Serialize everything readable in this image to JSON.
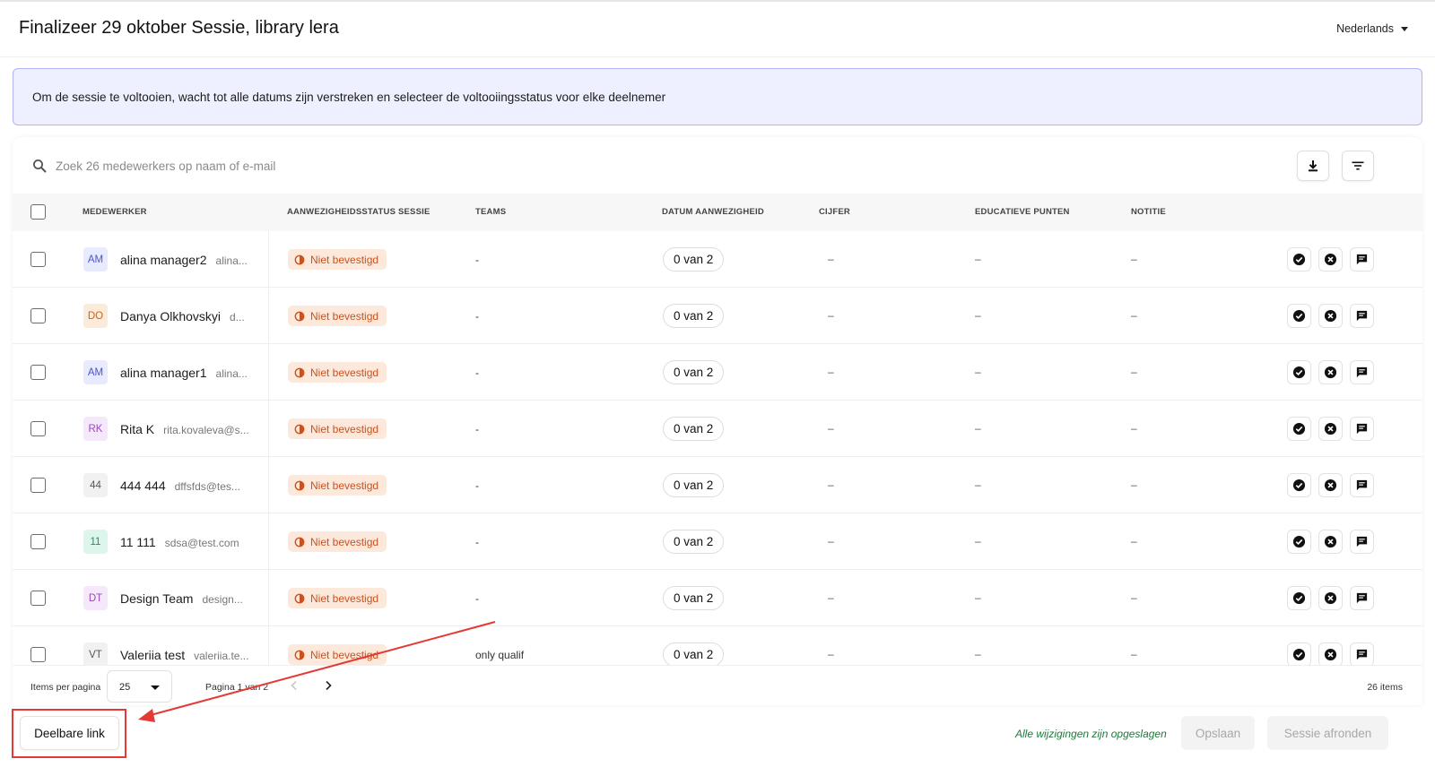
{
  "header": {
    "title": "Finalizeer 29 oktober Sessie, library lera",
    "language": "Nederlands"
  },
  "banner": {
    "text": "Om de sessie te voltooien, wacht tot alle datums zijn verstreken en selecteer de voltooiingsstatus voor elke deelnemer"
  },
  "search": {
    "placeholder": "Zoek 26 medewerkers op naam of e-mail"
  },
  "table": {
    "columns": {
      "employee": "MEDEWERKER",
      "attendance_status": "AANWEZIGHEIDSSTATUS SESSIE",
      "teams": "TEAMS",
      "attendance_date": "DATUM AANWEZIGHEID",
      "grade": "CIJFER",
      "edu_points": "EDUCATIEVE PUNTEN",
      "note": "NOTITIE"
    },
    "rows": [
      {
        "initials": "AM",
        "name": "alina manager2",
        "email": "alina...",
        "status": "Niet bevestigd",
        "team": "-",
        "date": "0 van 2",
        "grade": "–",
        "points": "–",
        "note": "–"
      },
      {
        "initials": "DO",
        "name": "Danya Olkhovskyi",
        "email": "d...",
        "status": "Niet bevestigd",
        "team": "-",
        "date": "0 van 2",
        "grade": "–",
        "points": "–",
        "note": "–"
      },
      {
        "initials": "AM",
        "name": "alina manager1",
        "email": "alina...",
        "status": "Niet bevestigd",
        "team": "-",
        "date": "0 van 2",
        "grade": "–",
        "points": "–",
        "note": "–"
      },
      {
        "initials": "RK",
        "name": "Rita K",
        "email": "rita.kovaleva@s...",
        "status": "Niet bevestigd",
        "team": "-",
        "date": "0 van 2",
        "grade": "–",
        "points": "–",
        "note": "–"
      },
      {
        "initials": "44",
        "name": "444 444",
        "email": "dffsfds@tes...",
        "status": "Niet bevestigd",
        "team": "-",
        "date": "0 van 2",
        "grade": "–",
        "points": "–",
        "note": "–"
      },
      {
        "initials": "11",
        "name": "11 111",
        "email": "sdsa@test.com",
        "status": "Niet bevestigd",
        "team": "-",
        "date": "0 van 2",
        "grade": "–",
        "points": "–",
        "note": "–"
      },
      {
        "initials": "DT",
        "name": "Design Team",
        "email": "design...",
        "status": "Niet bevestigd",
        "team": "-",
        "date": "0 van 2",
        "grade": "–",
        "points": "–",
        "note": "–"
      },
      {
        "initials": "VT",
        "name": "Valeriia test",
        "email": "valeriia.te...",
        "status": "Niet bevestigd",
        "team": "only qualif",
        "date": "0 van 2",
        "grade": "–",
        "points": "–",
        "note": "–"
      }
    ]
  },
  "avatar_colors": [
    {
      "bg": "#e8eaff",
      "fg": "#4a55c9"
    },
    {
      "bg": "#fdebd9",
      "fg": "#c8641c"
    },
    {
      "bg": "#e8eaff",
      "fg": "#4a55c9"
    },
    {
      "bg": "#f6e8fb",
      "fg": "#9a49b8"
    },
    {
      "bg": "#f1f1f1",
      "fg": "#555555"
    },
    {
      "bg": "#dcf6ec",
      "fg": "#2a8a60"
    },
    {
      "bg": "#f6e8fb",
      "fg": "#9a49b8"
    },
    {
      "bg": "#f1f1f1",
      "fg": "#555555"
    }
  ],
  "pagination": {
    "items_per_page_label": "Items per pagina",
    "items_per_page_value": "25",
    "page_info": "Pagina 1 van 2",
    "total_items": "26 items"
  },
  "footer": {
    "share_link": "Deelbare link",
    "saved_message": "Alle wijzigingen zijn opgeslagen",
    "save": "Opslaan",
    "finish_session": "Sessie afronden"
  },
  "icons": {
    "search": "search-icon",
    "download": "download-icon",
    "filter": "filter-icon",
    "status": "status-icon",
    "approve": "check-circle-icon",
    "reject": "x-circle-icon",
    "comment": "comment-icon"
  },
  "colors": {
    "banner_bg": "#eef0ff",
    "banner_border": "#aeb4f3",
    "status_bg": "#fde9dc",
    "status_fg": "#c9521f",
    "saved_green": "#1d7a3a",
    "annotation_red": "#e53935"
  }
}
